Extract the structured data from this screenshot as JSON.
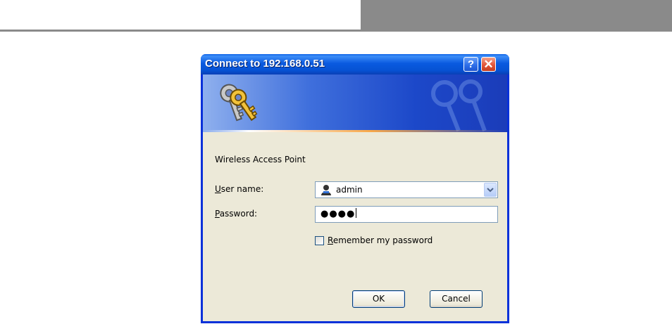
{
  "dialog": {
    "title": "Connect to 192.168.0.51",
    "help_glyph": "?",
    "close_glyph": "✕",
    "description": "Wireless Access Point",
    "username": {
      "label_accel": "U",
      "label_rest": "ser name:",
      "value": "admin",
      "icon": "user-icon"
    },
    "password": {
      "label_accel": "P",
      "label_rest": "assword:",
      "masked_value": "●●●●"
    },
    "remember": {
      "label_accel": "R",
      "label_rest": "emember my password",
      "checked": false
    },
    "buttons": {
      "ok": "OK",
      "cancel": "Cancel"
    }
  },
  "colors": {
    "titlebar": "#0a5ae0",
    "dialog_bg": "#ece9d8",
    "page_bar": "#8a8a8a"
  }
}
